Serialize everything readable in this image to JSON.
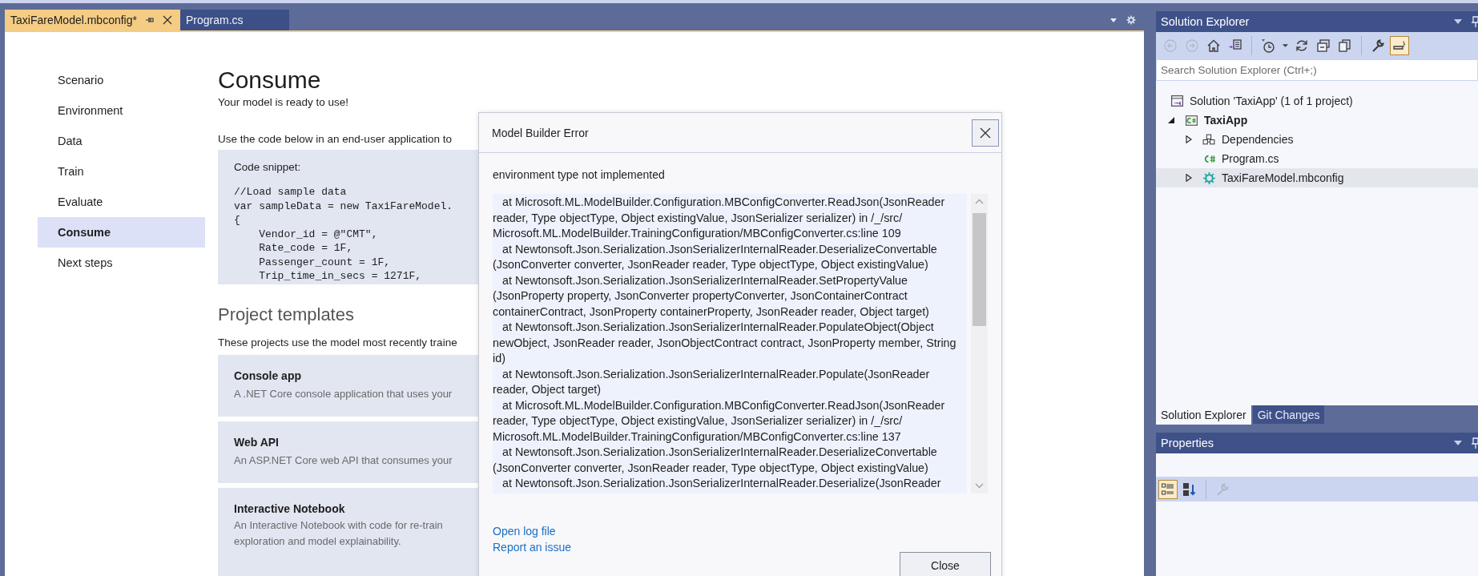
{
  "editor_tabs": [
    {
      "label": "TaxiFareModel.mbconfig*",
      "selected": true
    },
    {
      "label": "Program.cs",
      "selected": false
    }
  ],
  "nav": [
    {
      "label": "Scenario",
      "selected": false
    },
    {
      "label": "Environment",
      "selected": false
    },
    {
      "label": "Data",
      "selected": false
    },
    {
      "label": "Train",
      "selected": false
    },
    {
      "label": "Evaluate",
      "selected": false
    },
    {
      "label": "Consume",
      "selected": true
    },
    {
      "label": "Next steps",
      "selected": false
    }
  ],
  "consume": {
    "title": "Consume",
    "subtitle": "Your model is ready to use!",
    "intro": "Use the code below in an end-user application to",
    "snippet_label": "Code snippet:",
    "code_lines": [
      "//Load sample data",
      "var sampleData = new TaxiFareModel.",
      "{",
      "    Vendor_id = @\"CMT\",",
      "    Rate_code = 1F,",
      "    Passenger_count = 1F,",
      "    Trip_time_in_secs = 1271F,"
    ]
  },
  "project_templates": {
    "title": "Project templates",
    "intro": "These projects use the model most recently traine",
    "items": [
      {
        "title": "Console app",
        "description_lines": [
          "A .NET Core console application that uses your"
        ]
      },
      {
        "title": "Web API",
        "description_lines": [
          "An ASP.NET Core web API that consumes your"
        ]
      },
      {
        "title": "Interactive Notebook",
        "description_lines": [
          "An Interactive Notebook with code for re-train",
          "exploration and model explainability."
        ]
      }
    ]
  },
  "dialog": {
    "title": "Model Builder Error",
    "message": "environment type not implemented",
    "trace_lines": [
      {
        "kind": "frame",
        "text": "at Microsoft.ML.ModelBuilder.Configuration.MBConfigConverter.ReadJson(JsonReader"
      },
      {
        "kind": "cont",
        "text": "reader, Type objectType, Object existingValue, JsonSerializer serializer) in /_/src/"
      },
      {
        "kind": "cont",
        "text": "Microsoft.ML.ModelBuilder.TrainingConfiguration/MBConfigConverter.cs:line 109"
      },
      {
        "kind": "frame",
        "text": "at Newtonsoft.Json.Serialization.JsonSerializerInternalReader.DeserializeConvertable"
      },
      {
        "kind": "cont",
        "text": "(JsonConverter converter, JsonReader reader, Type objectType, Object existingValue)"
      },
      {
        "kind": "frame",
        "text": "at Newtonsoft.Json.Serialization.JsonSerializerInternalReader.SetPropertyValue"
      },
      {
        "kind": "cont",
        "text": "(JsonProperty property, JsonConverter propertyConverter, JsonContainerContract"
      },
      {
        "kind": "cont",
        "text": "containerContract, JsonProperty containerProperty, JsonReader reader, Object target)"
      },
      {
        "kind": "frame",
        "text": "at Newtonsoft.Json.Serialization.JsonSerializerInternalReader.PopulateObject(Object"
      },
      {
        "kind": "cont",
        "text": "newObject, JsonReader reader, JsonObjectContract contract, JsonProperty member, String"
      },
      {
        "kind": "cont",
        "text": "id)"
      },
      {
        "kind": "frame",
        "text": "at Newtonsoft.Json.Serialization.JsonSerializerInternalReader.Populate(JsonReader"
      },
      {
        "kind": "cont",
        "text": "reader, Object target)"
      },
      {
        "kind": "frame",
        "text": "at Microsoft.ML.ModelBuilder.Configuration.MBConfigConverter.ReadJson(JsonReader"
      },
      {
        "kind": "cont",
        "text": "reader, Type objectType, Object existingValue, JsonSerializer serializer) in /_/src/"
      },
      {
        "kind": "cont",
        "text": "Microsoft.ML.ModelBuilder.TrainingConfiguration/MBConfigConverter.cs:line 137"
      },
      {
        "kind": "frame",
        "text": "at Newtonsoft.Json.Serialization.JsonSerializerInternalReader.DeserializeConvertable"
      },
      {
        "kind": "cont",
        "text": "(JsonConverter converter, JsonReader reader, Type objectType, Object existingValue)"
      },
      {
        "kind": "frame",
        "text": "at Newtonsoft.Json.Serialization.JsonSerializerInternalReader.Deserialize(JsonReader"
      }
    ],
    "links": [
      "Open log file",
      "Report an issue"
    ],
    "close_button": "Close"
  },
  "solution_explorer": {
    "title": "Solution Explorer",
    "toolbar": [
      {
        "kind": "back",
        "disabled": true,
        "on": false
      },
      {
        "kind": "forward",
        "disabled": true,
        "on": false
      },
      {
        "kind": "home",
        "disabled": false,
        "on": false
      },
      {
        "kind": "switch-views",
        "disabled": false,
        "on": false
      },
      {
        "kind": "separator"
      },
      {
        "kind": "pending-changes",
        "disabled": false,
        "on": false
      },
      {
        "kind": "caret",
        "disabled": false,
        "on": false
      },
      {
        "kind": "refresh",
        "disabled": false,
        "on": false
      },
      {
        "kind": "collapse",
        "disabled": false,
        "on": false
      },
      {
        "kind": "show-all",
        "disabled": false,
        "on": false
      },
      {
        "kind": "separator"
      },
      {
        "kind": "properties",
        "disabled": false,
        "on": false
      },
      {
        "kind": "preview",
        "disabled": false,
        "on": true
      }
    ],
    "search": {
      "placeholder": "Search Solution Explorer (Ctrl+;)"
    },
    "tree": [
      {
        "kind": "solution",
        "label": "Solution 'TaxiApp' (1 of 1 project)",
        "selected": false,
        "children": [
          {
            "kind": "project",
            "label": "TaxiApp",
            "selected": false,
            "expanded": true,
            "children": [
              {
                "kind": "dependencies",
                "label": "Dependencies",
                "selected": false,
                "expanded": false
              },
              {
                "kind": "csharp-file",
                "label": "Program.cs",
                "selected": false
              },
              {
                "kind": "config",
                "label": "TaxiFareModel.mbconfig",
                "selected": true,
                "expanded": false
              }
            ]
          }
        ]
      }
    ]
  },
  "panel_tabs": [
    {
      "label": "Solution Explorer",
      "selected": true
    },
    {
      "label": "Git Changes",
      "selected": false
    }
  ],
  "properties": {
    "title": "Properties",
    "toolbar": [
      {
        "kind": "categorized",
        "disabled": false,
        "on": true
      },
      {
        "kind": "alphabetical",
        "disabled": false,
        "on": false
      },
      {
        "kind": "separator"
      },
      {
        "kind": "property-pages",
        "disabled": true,
        "on": false
      }
    ]
  }
}
